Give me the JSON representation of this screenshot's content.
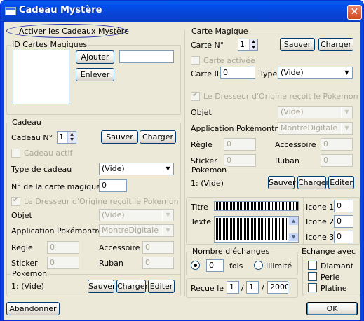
{
  "window": {
    "title": "Cadeau Mystère",
    "close_label": "✕"
  },
  "activate_link": "Activer les Cadeaux Mystère",
  "id_cards": {
    "legend": "ID Cartes Magiques",
    "add": "Ajouter",
    "remove": "Enlever",
    "input_value": ""
  },
  "cadeau": {
    "legend": "Cadeau",
    "number_label": "Cadeau N°",
    "number_value": "1",
    "save": "Sauver",
    "load": "Charger",
    "active_label": "Cadeau actif",
    "type_label": "Type de cadeau",
    "type_value": "(Vide)",
    "card_number_label": "N° de la carte magique",
    "card_number_value": "0",
    "ot_label": "Le Dresseur d'Origine reçoit le Pokemon",
    "object_label": "Objet",
    "object_value": "(Vide)",
    "app_label": "Application Pokémontre",
    "app_value": "MontreDigitale",
    "rule_label": "Règle",
    "rule_value": "0",
    "accessory_label": "Accessoire",
    "accessory_value": "0",
    "sticker_label": "Sticker",
    "sticker_value": "0",
    "ribbon_label": "Ruban",
    "ribbon_value": "0",
    "pokemon_legend": "Pokemon",
    "pokemon_value": "1: (Vide)",
    "p_save": "Sauver",
    "p_load": "Charger",
    "p_edit": "Editer"
  },
  "carte": {
    "legend": "Carte Magique",
    "number_label": "Carte N°",
    "number_value": "1",
    "save": "Sauver",
    "load": "Charger",
    "active_label": "Carte activée",
    "id_label": "Carte ID",
    "id_value": "0",
    "type_label": "Type",
    "type_value": "(Vide)",
    "ot_label": "Le Dresseur d'Origine reçoit le Pokemon",
    "object_label": "Objet",
    "object_value": "(Vide)",
    "app_label": "Application Pokémontre",
    "app_value": "MontreDigitale",
    "rule_label": "Règle",
    "rule_value": "0",
    "accessory_label": "Accessoire",
    "accessory_value": "0",
    "sticker_label": "Sticker",
    "sticker_value": "0",
    "ribbon_label": "Ruban",
    "ribbon_value": "0",
    "pokemon_legend": "Pokemon",
    "pokemon_value": "1: (Vide)",
    "p_save": "Sauver",
    "p_load": "Charger",
    "p_edit": "Editer",
    "title_label": "Titre",
    "text_label": "Texte",
    "icon1_label": "Icone 1",
    "icon1_value": "0",
    "icon2_label": "Icone 2",
    "icon2_value": "0",
    "icon3_label": "Icone 3",
    "icon3_value": "0",
    "exchanges_legend": "Nombre d'échanges",
    "exchanges_value": "0",
    "times_label": "fois",
    "unlimited_label": "Illimité",
    "exchange_with_legend": "Echange avec",
    "diamond_label": "Diamant",
    "pearl_label": "Perle",
    "platinum_label": "Platine",
    "received_label": "Reçue le",
    "day": "1",
    "month": "1",
    "year": "2000",
    "sep1": "/",
    "sep2": "/"
  },
  "footer": {
    "abandon": "Abandonner",
    "ok": "OK"
  }
}
